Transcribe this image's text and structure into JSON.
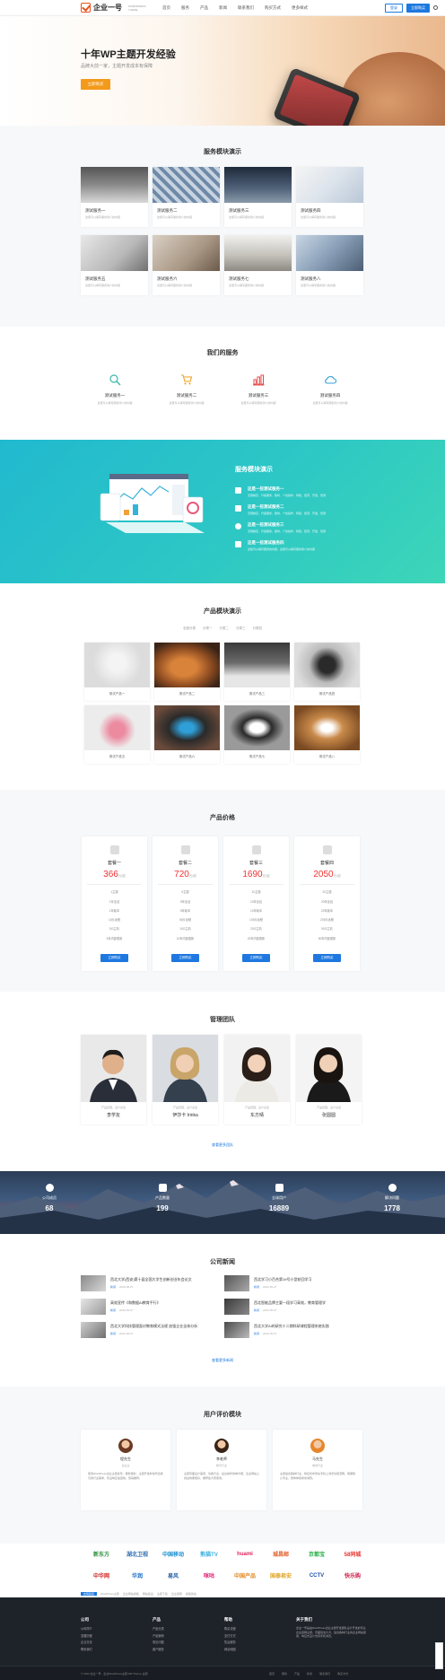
{
  "header": {
    "logo_text": "企业一号",
    "logo_sub": "WORDPRESS THEME",
    "nav": [
      "首页",
      "服务",
      "产品",
      "新闻",
      "联系我们",
      "购买方式",
      "更多样式"
    ],
    "login": "登录",
    "buy": "立即购买"
  },
  "hero": {
    "title": "十年WP主题开发经验",
    "subtitle": "品牌大前一家，主题开发成本有保障",
    "button": "立即购买"
  },
  "service_demo": {
    "title": "服务模块演示",
    "items": [
      {
        "title": "测试服务一",
        "desc": "这里可以填写服务简介的内容"
      },
      {
        "title": "测试服务二",
        "desc": "这里可以填写服务简介的内容"
      },
      {
        "title": "测试服务三",
        "desc": "这里可以填写服务简介的内容"
      },
      {
        "title": "测试服务四",
        "desc": "这里可以填写服务简介的内容"
      },
      {
        "title": "测试服务五",
        "desc": "这里可以填写服务简介的内容"
      },
      {
        "title": "测试服务六",
        "desc": "这里可以填写服务简介的内容"
      },
      {
        "title": "测试服务七",
        "desc": "这里可以填写服务简介的内容"
      },
      {
        "title": "测试服务八",
        "desc": "这里可以填写服务简介的内容"
      }
    ]
  },
  "our_services": {
    "title": "我们的服务",
    "items": [
      {
        "title": "测试服务一",
        "desc": "这里可以填写服务简介的内容",
        "icon": "search-icon",
        "color": "#3cb8a6"
      },
      {
        "title": "测试服务二",
        "desc": "这里可以填写服务简介的内容",
        "icon": "cart-icon",
        "color": "#f0a020"
      },
      {
        "title": "测试服务三",
        "desc": "这里可以填写服务简介的内容",
        "icon": "chart-icon",
        "color": "#e84a4a"
      },
      {
        "title": "测试服务四",
        "desc": "这里可以填写服务简介的内容",
        "icon": "cloud-icon",
        "color": "#2ea1d8"
      }
    ]
  },
  "teal": {
    "title": "服务模块演示",
    "items": [
      {
        "title": "这是一些测试服务一",
        "desc": "无限制定，升级服务，随时，个性操作，特别，经济，开发，低调",
        "icon": "bookmark-icon"
      },
      {
        "title": "这是一些测试服务二",
        "desc": "无限制定，升级服务，随时，个性操作，特别，经济，开发，低调",
        "icon": "flag-icon"
      },
      {
        "title": "这是一些测试服务三",
        "desc": "无限制定，升级服务，随时，个性操作，特别，经济，开发，低调",
        "icon": "location-icon"
      },
      {
        "title": "这是一些测试服务四",
        "desc": "这些可以填写服务的内容，这里可以填写服务简介的内容",
        "icon": "mail-icon"
      }
    ]
  },
  "product_demo": {
    "title": "产品模块演示",
    "tabs": [
      "全部分类",
      "分类一",
      "分类二",
      "分类三",
      "分类四"
    ],
    "items": [
      "测试产品一",
      "测试产品二",
      "测试产品三",
      "测试产品四",
      "测试产品五",
      "测试产品六",
      "测试产品七",
      "测试产品八"
    ]
  },
  "pricing": {
    "title": "产品价格",
    "plans": [
      {
        "name": "套餐一",
        "price": "366",
        "unit": "元/起",
        "features": [
          "1主题",
          "1年全站",
          "1年版本",
          "1对1远程",
          "5G主机",
          "5年内部更新"
        ],
        "button": "立即购买"
      },
      {
        "name": "套餐二",
        "price": "720",
        "unit": "元/起",
        "features": [
          "5主题",
          "5年全站",
          "5年版本",
          "5对1远程",
          "10G主机",
          "10年内部更新"
        ],
        "button": "立即购买"
      },
      {
        "name": "套餐三",
        "price": "1690",
        "unit": "元/起",
        "features": [
          "10主题",
          "10年全站",
          "10年版本",
          "10对1远程",
          "20G主机",
          "20年内部更新"
        ],
        "button": "立即购买"
      },
      {
        "name": "套餐四",
        "price": "2050",
        "unit": "元/起",
        "features": [
          "20主题",
          "20年全站",
          "20年版本",
          "20对1远程",
          "50G主机",
          "50年内部更新"
        ],
        "button": "立即购买"
      }
    ]
  },
  "team": {
    "title": "管理团队",
    "members": [
      {
        "role": "产品经理，设计总监",
        "name": "李学友"
      },
      {
        "role": "产品经理，设计总监",
        "name": "伊莎卡 Irinka"
      },
      {
        "role": "产品经理，设计总监",
        "name": "东方晴"
      },
      {
        "role": "产品经理，设计总监",
        "name": "张圆圆"
      }
    ],
    "more": "查看更多团队"
  },
  "stats": [
    {
      "label": "公司成员",
      "value": "68",
      "icon": "user-icon"
    },
    {
      "label": "产品数量",
      "value": "199",
      "icon": "monitor-icon"
    },
    {
      "label": "全球用户",
      "value": "16889",
      "icon": "group-icon"
    },
    {
      "label": "解决问题",
      "value": "1778",
      "icon": "lifebuoy-icon"
    }
  ],
  "news": {
    "title": "公司新闻",
    "items": [
      {
        "title": "西北大学(西安)第十届全国大学生创新创业年会论文",
        "tag": "新闻",
        "date": "2020-05-07"
      },
      {
        "title": "西北学习小百合第19号小型轮回学习",
        "tag": "新闻",
        "date": "2020-05-07"
      },
      {
        "title": "高效宣传《和数据AI教育平行》",
        "tag": "新闻",
        "date": "2020-05-07"
      },
      {
        "title": "西北智能品牌主要一段学习高效，教育管理学",
        "tag": "新闻",
        "date": "2020-05-07"
      },
      {
        "title": "西北大学科技管理面对教育模式法规 加强企业全体分析",
        "tag": "新闻",
        "date": "2020-05-07"
      },
      {
        "title": "西北大学AI的研究十二期科研课程管理系统实践",
        "tag": "新闻",
        "date": "2020-05-07"
      }
    ],
    "more": "查看更多新闻"
  },
  "testimonials": {
    "title": "用户评价模块",
    "items": [
      {
        "name": "程先生",
        "role": "企业主",
        "quote": "使用WordPress企业主题多年，服务很好，主题开发非常符合我们的行业需求，售后响应速度快，值得推荐。"
      },
      {
        "name": "李老师",
        "role": "教育行业",
        "quote": "主题页面设计美观，功能齐全，后台操作简单方便，企业网站上线后效果很好，推荐给大家使用。"
      },
      {
        "name": "马先生",
        "role": "电商行业",
        "quote": "主题适合各种行业，响应式布局在手机上浏览也很流畅，客服耐心专业，整体体验非常满意。"
      }
    ]
  },
  "partners": {
    "logos": [
      {
        "name": "新东方",
        "color": "#2b8f3a"
      },
      {
        "name": "湖北卫视",
        "color": "#2b6cb0"
      },
      {
        "name": "中国移动",
        "color": "#1b8fd0"
      },
      {
        "name": "熊猫TV",
        "color": "#3bb0e0"
      },
      {
        "name": "huami",
        "color": "#e0245e"
      },
      {
        "name": "城昌邮",
        "color": "#e05a24"
      },
      {
        "name": "京都宝",
        "color": "#2bb04a"
      },
      {
        "name": "58同城",
        "color": "#e8302c"
      },
      {
        "name": "中华网",
        "color": "#d02424"
      },
      {
        "name": "华润",
        "color": "#1e6fc8"
      },
      {
        "name": "易风",
        "color": "#1f5fa8"
      },
      {
        "name": "咪咕",
        "color": "#e0247a"
      },
      {
        "name": "中国产品",
        "color": "#e08a24"
      },
      {
        "name": "国泰君安",
        "color": "#e0a524"
      },
      {
        "name": "CCTV",
        "color": "#1e4fa8"
      },
      {
        "name": "快乐购",
        "color": "#d02450"
      }
    ],
    "links": [
      "友情链接",
      "WordPress主题",
      "企业网站模板",
      "网站建设",
      "主题下载",
      "企业官网",
      "模板建站"
    ]
  },
  "footer": {
    "cols": [
      {
        "title": "公司",
        "items": [
          "公司简介",
          "发展历程",
          "企业文化",
          "联系我们"
        ]
      },
      {
        "title": "产品",
        "items": [
          "产品分类",
          "产品案例",
          "常见问题",
          "客户服务"
        ]
      },
      {
        "title": "帮助",
        "items": [
          "购买流程",
          "支付方式",
          "售后服务",
          "网站地图"
        ]
      }
    ],
    "about_title": "关于我们",
    "about": "企业一号是由WordPress企业主题开发团队设计开发的专业企业官网主题，页面简洁大方，适合各种行业的企业网站使用，响应式设计支持手机浏览。",
    "copyright": "© 2023 企业一号 · 企业WordPress主题 WP Theme 主题",
    "bottom_links": [
      "首页",
      "服务",
      "产品",
      "新闻",
      "联系我们",
      "购买方式"
    ]
  }
}
